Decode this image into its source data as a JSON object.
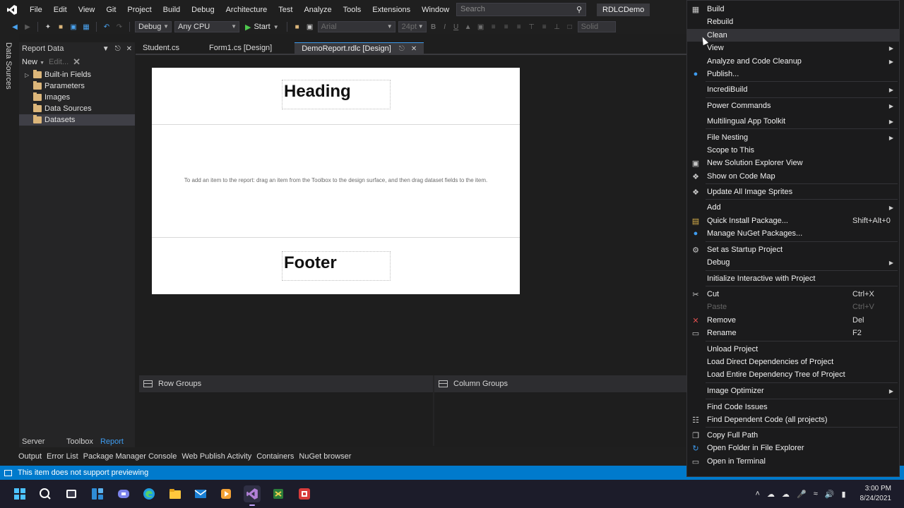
{
  "menu": {
    "items": [
      "File",
      "Edit",
      "View",
      "Git",
      "Project",
      "Build",
      "Debug",
      "Architecture",
      "Test",
      "Analyze",
      "Tools",
      "Extensions",
      "Window",
      "Help"
    ],
    "search_placeholder": "Search",
    "solution_name": "RDLCDemo"
  },
  "toolbar": {
    "configuration": "Debug",
    "platform": "Any CPU",
    "start_label": "Start",
    "font_name": "Arial",
    "font_size": "24pt",
    "border_style": "Solid",
    "format_letters": [
      "B",
      "I",
      "U"
    ]
  },
  "left_strip": {
    "data_sources_label": "Data Sources"
  },
  "report_data": {
    "title": "Report Data",
    "new_label": "New",
    "edit_label": "Edit...",
    "tree": [
      {
        "label": "Built-in Fields",
        "expandable": true
      },
      {
        "label": "Parameters",
        "expandable": false
      },
      {
        "label": "Images",
        "expandable": false
      },
      {
        "label": "Data Sources",
        "expandable": false
      },
      {
        "label": "Datasets",
        "expandable": false,
        "selected": true
      }
    ],
    "bottom_tabs": [
      "Server Ex...",
      "Toolbox",
      "Report D..."
    ],
    "active_bottom_tab": "Report D..."
  },
  "doc_tabs": [
    "Student.cs",
    "Form1.cs [Design]",
    "DemoReport.rdlc [Design]"
  ],
  "active_doc_tab": "DemoReport.rdlc [Design]",
  "report": {
    "heading": "Heading",
    "body_hint": "To add an item to the report: drag an item from the Toolbox to the design surface, and then drag dataset fields to the item.",
    "footer": "Footer"
  },
  "groups": {
    "row_groups": "Row Groups",
    "column_groups": "Column Groups"
  },
  "output_tabs": [
    "Output",
    "Error List",
    "Package Manager Console",
    "Web Publish Activity",
    "Containers",
    "NuGet browser"
  ],
  "status": {
    "message": "This item does not support previewing"
  },
  "context_menu": {
    "items": [
      {
        "label": "Build",
        "icon": "build-icon",
        "shortcut": "",
        "submenu": false
      },
      {
        "label": "Rebuild",
        "icon": "",
        "shortcut": "",
        "submenu": false
      },
      {
        "label": "Clean",
        "icon": "",
        "shortcut": "",
        "submenu": false,
        "hover": true
      },
      {
        "label": "View",
        "icon": "",
        "shortcut": "",
        "submenu": true
      },
      {
        "label": "Analyze and Code Cleanup",
        "icon": "",
        "shortcut": "",
        "submenu": true
      },
      {
        "label": "Publish...",
        "icon": "globe-icon",
        "shortcut": "",
        "submenu": false
      },
      {
        "label": "IncrediBuild",
        "icon": "",
        "shortcut": "",
        "submenu": true
      },
      {
        "label": "Power Commands",
        "icon": "",
        "shortcut": "",
        "submenu": true
      },
      {
        "label": "Multilingual App Toolkit",
        "icon": "",
        "shortcut": "",
        "submenu": true
      },
      {
        "label": "File Nesting",
        "icon": "",
        "shortcut": "",
        "submenu": true
      },
      {
        "label": "Scope to This",
        "icon": "",
        "shortcut": "",
        "submenu": false
      },
      {
        "label": "New Solution Explorer View",
        "icon": "window-icon",
        "shortcut": "",
        "submenu": false
      },
      {
        "label": "Show on Code Map",
        "icon": "code-map-icon",
        "shortcut": "",
        "submenu": false
      },
      {
        "label": "Update All Image Sprites",
        "icon": "sprites-icon",
        "shortcut": "",
        "submenu": false
      },
      {
        "label": "Add",
        "icon": "",
        "shortcut": "",
        "submenu": true
      },
      {
        "label": "Quick Install Package...",
        "icon": "package-icon",
        "shortcut": "Shift+Alt+0",
        "submenu": false
      },
      {
        "label": "Manage NuGet Packages...",
        "icon": "nuget-icon",
        "shortcut": "",
        "submenu": false
      },
      {
        "label": "Set as Startup Project",
        "icon": "gear-icon",
        "shortcut": "",
        "submenu": false
      },
      {
        "label": "Debug",
        "icon": "",
        "shortcut": "",
        "submenu": true
      },
      {
        "label": "Initialize Interactive with Project",
        "icon": "",
        "shortcut": "",
        "submenu": false
      },
      {
        "label": "Cut",
        "icon": "scissors-icon",
        "shortcut": "Ctrl+X",
        "submenu": false
      },
      {
        "label": "Paste",
        "icon": "",
        "shortcut": "Ctrl+V",
        "submenu": false,
        "disabled": true
      },
      {
        "label": "Remove",
        "icon": "remove-x-icon",
        "shortcut": "Del",
        "submenu": false
      },
      {
        "label": "Rename",
        "icon": "rename-icon",
        "shortcut": "F2",
        "submenu": false
      },
      {
        "label": "Unload Project",
        "icon": "",
        "shortcut": "",
        "submenu": false
      },
      {
        "label": "Load Direct Dependencies of Project",
        "icon": "",
        "shortcut": "",
        "submenu": false
      },
      {
        "label": "Load Entire Dependency Tree of Project",
        "icon": "",
        "shortcut": "",
        "submenu": false
      },
      {
        "label": "Image Optimizer",
        "icon": "",
        "shortcut": "",
        "submenu": true
      },
      {
        "label": "Find Code Issues",
        "icon": "",
        "shortcut": "",
        "submenu": false
      },
      {
        "label": "Find Dependent Code (all projects)",
        "icon": "dependency-icon",
        "shortcut": "",
        "submenu": false
      },
      {
        "label": "Copy Full Path",
        "icon": "copy-icon",
        "shortcut": "",
        "submenu": false
      },
      {
        "label": "Open Folder in File Explorer",
        "icon": "open-folder-icon",
        "shortcut": "",
        "submenu": false
      },
      {
        "label": "Open in Terminal",
        "icon": "terminal-icon",
        "shortcut": "",
        "submenu": false
      }
    ]
  },
  "taskbar": {
    "apps": [
      "windows-start-icon",
      "search-icon",
      "task-view-icon",
      "widgets-icon",
      "teams-chat-icon",
      "edge-icon",
      "file-explorer-icon",
      "mail-icon",
      "media-player-icon",
      "visual-studio-icon",
      "vs-code-icon",
      "camtasia-icon"
    ],
    "time": "3:00 PM",
    "date": "8/24/2021"
  }
}
